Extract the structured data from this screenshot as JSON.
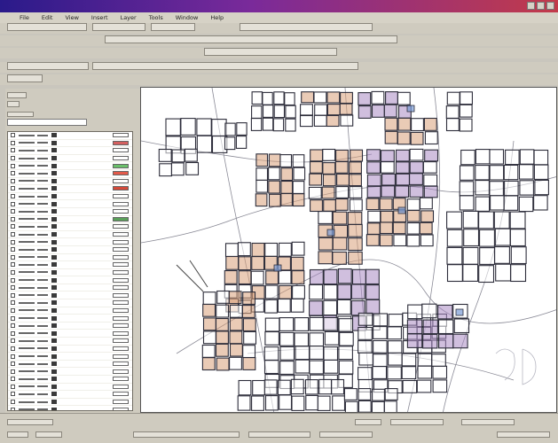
{
  "window": {
    "menu_items": [
      "File",
      "Edit",
      "View",
      "Insert",
      "Layer",
      "Tools",
      "Window",
      "Help"
    ]
  },
  "colors": {
    "titlebar_start": "#2a1a8a",
    "titlebar_end": "#c23a4a",
    "parcel_orange": "#d9a07a",
    "parcel_purple": "#a98ac2",
    "parcel_blue": "#7b9bd6",
    "outline": "#2d2d3a"
  },
  "icons": [
    "minimize-icon",
    "maximize-icon",
    "close-icon"
  ],
  "layers": [
    {
      "swatch": "#ffffff"
    },
    {
      "swatch": "#d46060"
    },
    {
      "swatch": "#ffffff"
    },
    {
      "swatch": "#ffffff"
    },
    {
      "swatch": "#6abf6a"
    },
    {
      "swatch": "#e35a4a"
    },
    {
      "swatch": "#ffffff"
    },
    {
      "swatch": "#d44a3a"
    },
    {
      "swatch": "#ffffff"
    },
    {
      "swatch": "#ffffff"
    },
    {
      "swatch": "#ffffff"
    },
    {
      "swatch": "#5aa05a"
    },
    {
      "swatch": "#ffffff"
    },
    {
      "swatch": "#ffffff"
    },
    {
      "swatch": "#ffffff"
    },
    {
      "swatch": "#ffffff"
    },
    {
      "swatch": "#ffffff"
    },
    {
      "swatch": "#ffffff"
    },
    {
      "swatch": "#ffffff"
    },
    {
      "swatch": "#ffffff"
    },
    {
      "swatch": "#ffffff"
    },
    {
      "swatch": "#ffffff"
    },
    {
      "swatch": "#ffffff"
    },
    {
      "swatch": "#ffffff"
    },
    {
      "swatch": "#ffffff"
    },
    {
      "swatch": "#ffffff"
    },
    {
      "swatch": "#ffffff"
    },
    {
      "swatch": "#ffffff"
    },
    {
      "swatch": "#ffffff"
    },
    {
      "swatch": "#ffffff"
    },
    {
      "swatch": "#ffffff"
    },
    {
      "swatch": "#ffffff"
    },
    {
      "swatch": "#ffffff"
    },
    {
      "swatch": "#ffffff"
    },
    {
      "swatch": "#ffffff"
    },
    {
      "swatch": "#ffffff"
    },
    {
      "swatch": "#ffffff"
    },
    {
      "swatch": "#ffffff"
    },
    {
      "swatch": "#ffffff"
    },
    {
      "swatch": "#ffffff"
    }
  ]
}
